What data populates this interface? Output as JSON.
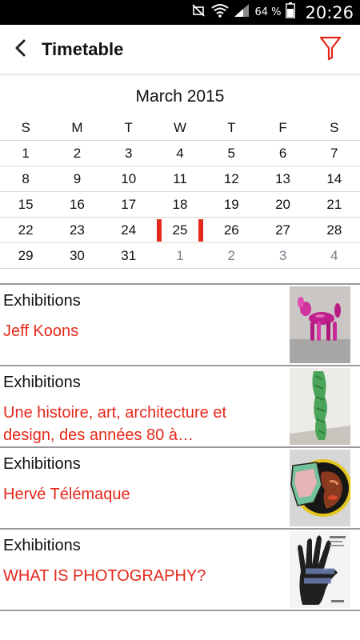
{
  "status_bar": {
    "battery_percent": "64 %",
    "time": "20:26"
  },
  "app_bar": {
    "title": "Timetable",
    "accent_color": "#e5281a"
  },
  "calendar": {
    "month": "March 2015",
    "weekdays": [
      "S",
      "M",
      "T",
      "W",
      "T",
      "F",
      "S"
    ],
    "weeks": [
      [
        "1",
        "2",
        "3",
        "4",
        "5",
        "6",
        "7"
      ],
      [
        "8",
        "9",
        "10",
        "11",
        "12",
        "13",
        "14"
      ],
      [
        "15",
        "16",
        "17",
        "18",
        "19",
        "20",
        "21"
      ],
      [
        "22",
        "23",
        "24",
        "25",
        "26",
        "27",
        "28"
      ],
      [
        "29",
        "30",
        "31",
        "1",
        "2",
        "3",
        "4"
      ]
    ],
    "selected_day": "25"
  },
  "events": [
    {
      "category": "Exhibitions",
      "title": "Jeff Koons"
    },
    {
      "category": "Exhibitions",
      "title": "Une histoire, art, architecture et design, des années 80 à…"
    },
    {
      "category": "Exhibitions",
      "title": "Hervé Télémaque"
    },
    {
      "category": "Exhibitions",
      "title": "WHAT IS PHOTOGRAPHY?"
    }
  ]
}
